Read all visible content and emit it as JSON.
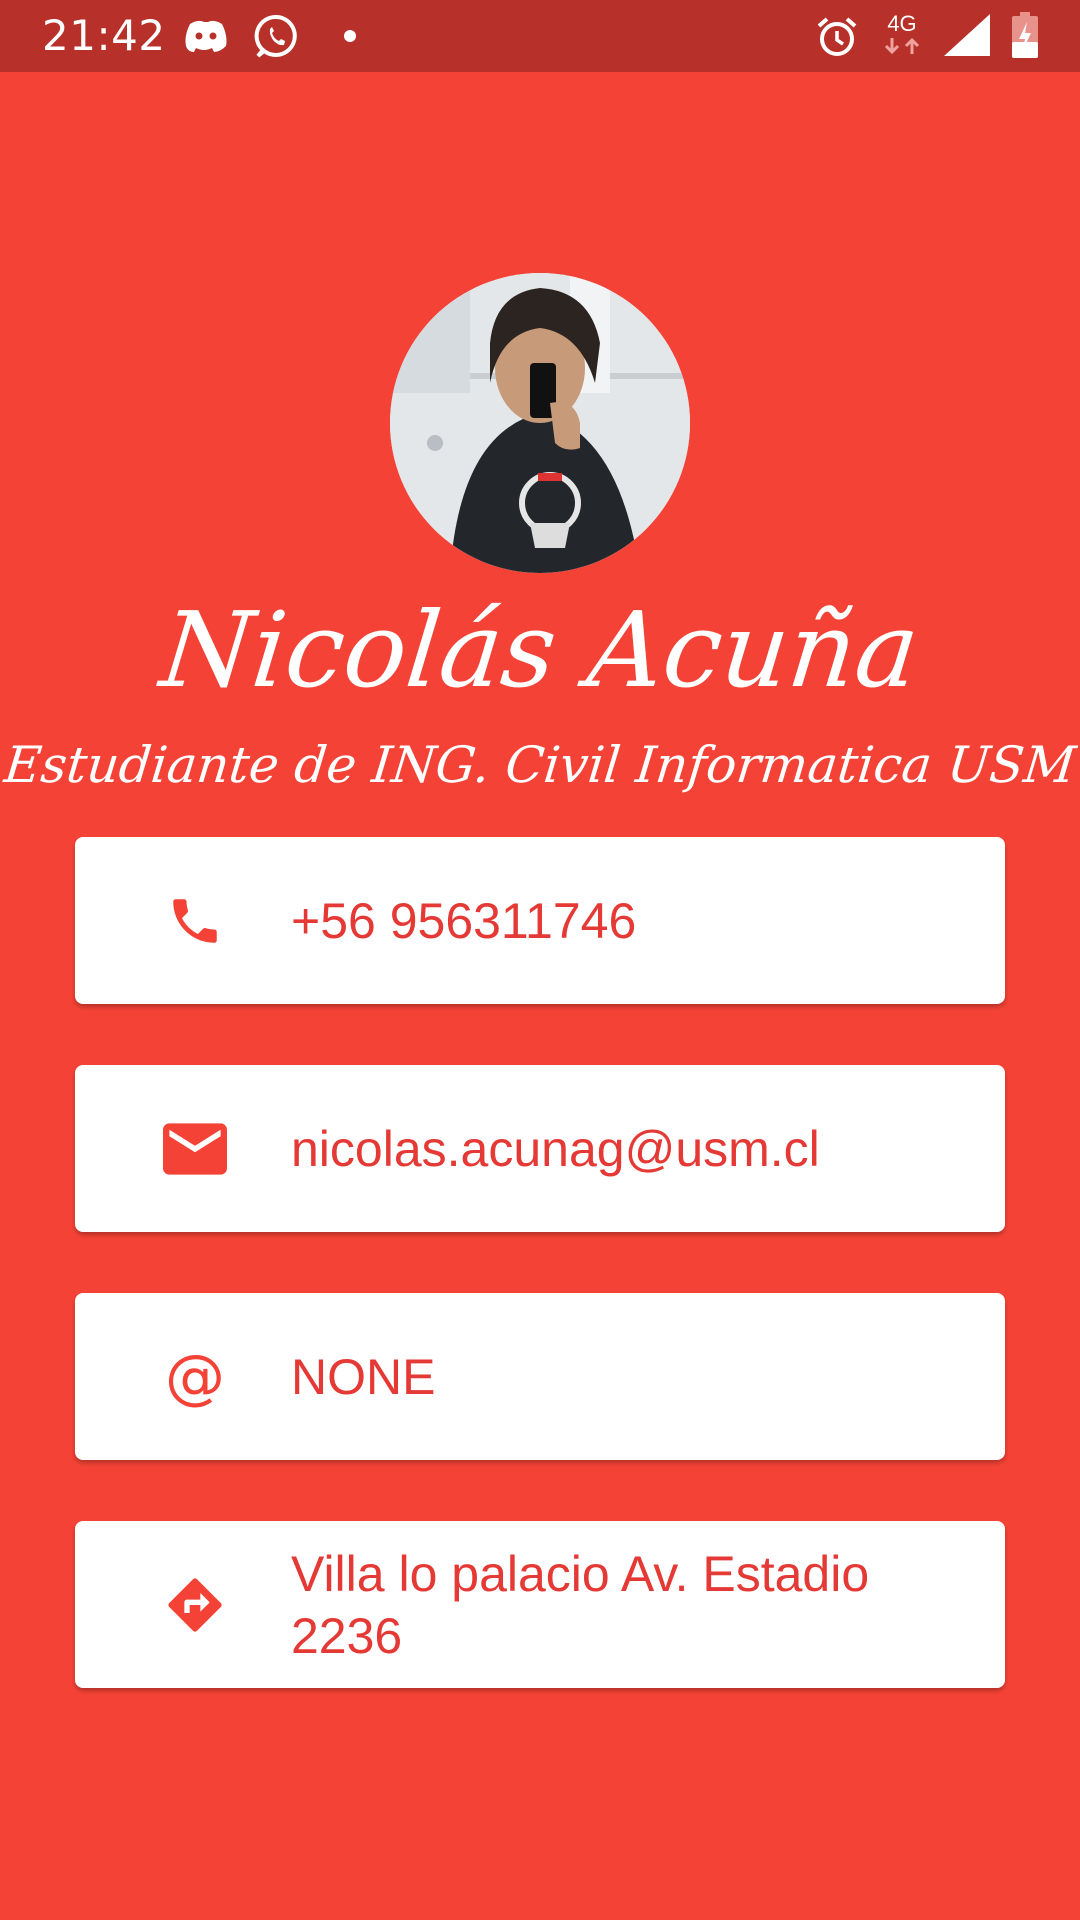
{
  "status_bar": {
    "time": "21:42",
    "network": "4G",
    "icons": [
      "discord-icon",
      "whatsapp-icon",
      "notification-dot-icon",
      "alarm-icon",
      "network-4g-icon",
      "signal-icon",
      "battery-charging-icon"
    ]
  },
  "profile": {
    "name": "Nicolás Acuña",
    "subtitle": "Estudiante de ING. Civil Informatica USM"
  },
  "contacts": [
    {
      "icon": "phone-icon",
      "value": "+56 956311746"
    },
    {
      "icon": "email-icon",
      "value": "nicolas.acunag@usm.cl"
    },
    {
      "icon": "at-icon",
      "icon_glyph": "@",
      "value": "NONE"
    },
    {
      "icon": "directions-icon",
      "value": "Villa lo palacio Av. Estadio 2236"
    }
  ],
  "colors": {
    "background": "#f44336",
    "status_bar": "#b7302a",
    "card": "#ffffff",
    "accent_text": "#e53935"
  }
}
